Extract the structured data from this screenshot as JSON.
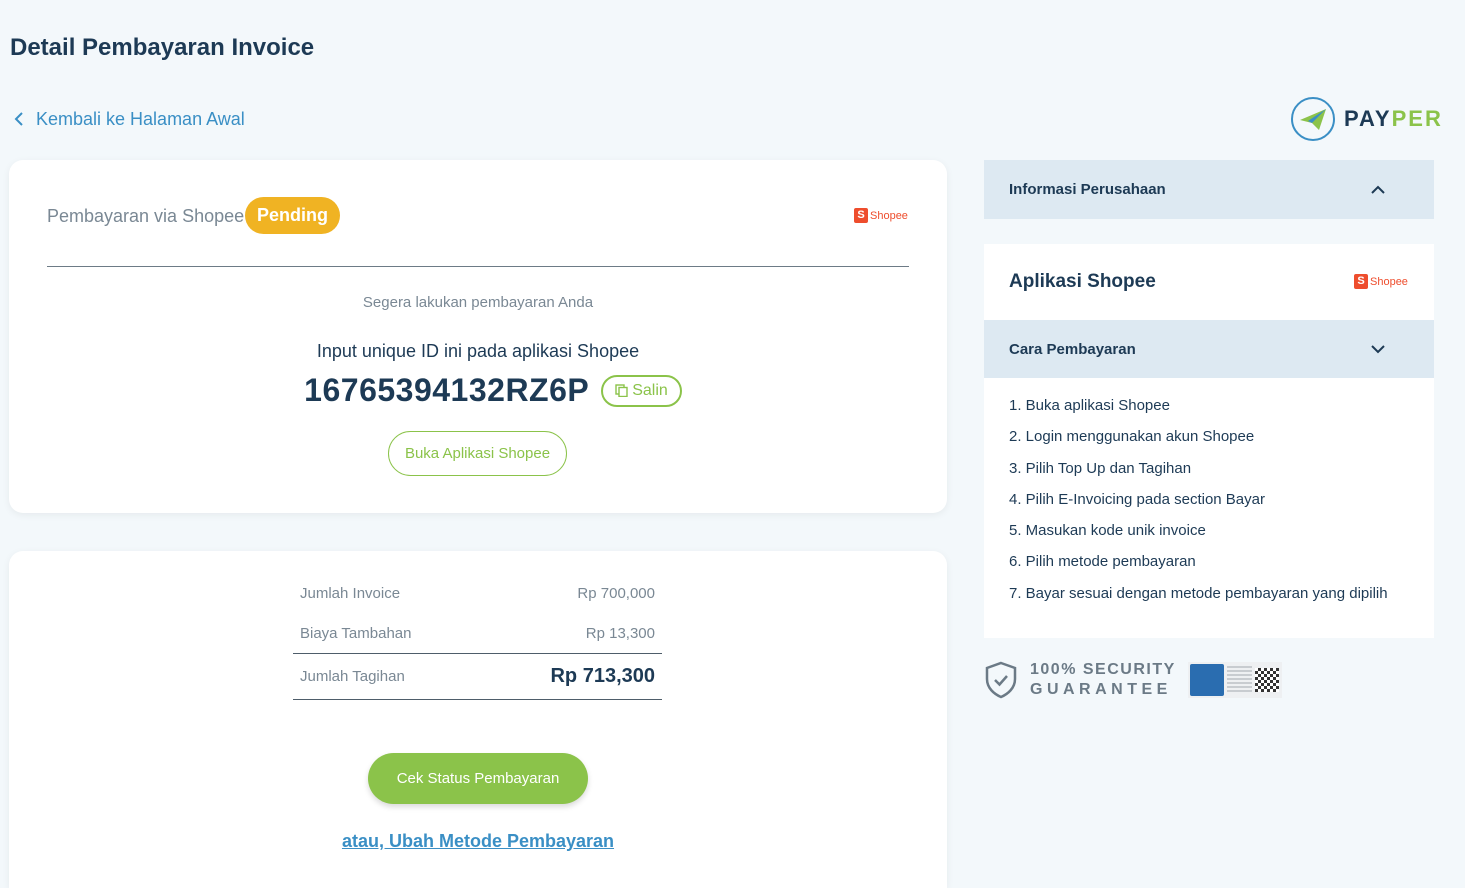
{
  "page": {
    "title": "Detail Pembayaran Invoice"
  },
  "nav": {
    "back_label": "Kembali ke Halaman Awal"
  },
  "brand": {
    "name_prefix": "PAY",
    "name_suffix": "PER"
  },
  "payment": {
    "method_label": "Pembayaran via Shopee",
    "status": "Pending",
    "provider_logo_text": "Shopee",
    "prompt": "Segera lakukan pembayaran Anda",
    "input_label": "Input unique ID ini pada aplikasi Shopee",
    "unique_id": "16765394132RZ6P",
    "copy_label": "Salin",
    "open_app_label": "Buka Aplikasi Shopee"
  },
  "summary": {
    "rows": [
      {
        "label": "Jumlah Invoice",
        "value": "Rp 700,000"
      },
      {
        "label": "Biaya Tambahan",
        "value": "Rp 13,300"
      }
    ],
    "total_label": "Jumlah Tagihan",
    "total_value": "Rp 713,300",
    "check_status_label": "Cek Status Pembayaran",
    "change_method_label": "atau, Ubah Metode Pembayaran"
  },
  "sidebar": {
    "company_header": "Informasi Perusahaan",
    "app_title": "Aplikasi Shopee",
    "app_logo_text": "Shopee",
    "how_header": "Cara Pembayaran",
    "steps": [
      "1. Buka aplikasi Shopee",
      "2. Login menggunakan akun Shopee",
      "3. Pilih Top Up dan Tagihan",
      "4. Pilih E-Invoicing pada section Bayar",
      "5. Masukan kode unik invoice",
      "6. Pilih metode pembayaran",
      "7. Bayar sesuai dengan metode pembayaran yang dipilih"
    ]
  },
  "security": {
    "line1": "100% SECURITY",
    "line2": "GUARANTEE"
  },
  "colors": {
    "accent_green": "#8bc34a",
    "pending": "#f0b323",
    "link_blue": "#3a8fc5",
    "navy": "#1d3a55",
    "shopee": "#ee4d2d"
  },
  "icons": {
    "back": "chevron-left-icon",
    "copy": "copy-icon",
    "collapse": "chevron-up-icon",
    "expand": "chevron-down-icon",
    "shield": "shield-check-icon"
  }
}
